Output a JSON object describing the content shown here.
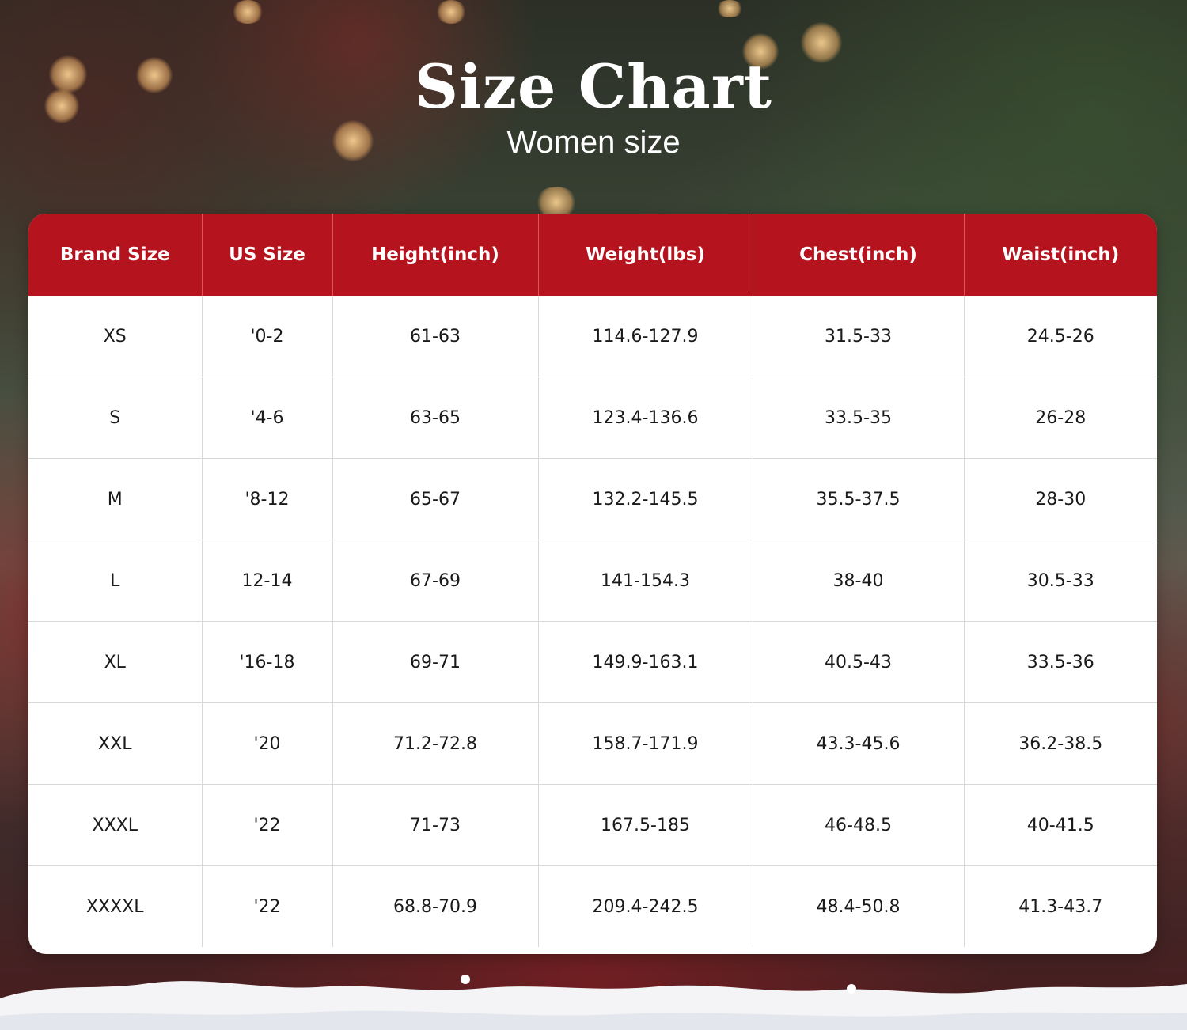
{
  "header": {
    "title": "Size Chart",
    "subtitle": "Women size"
  },
  "table": {
    "columns": [
      "Brand Size",
      "US Size",
      "Height(inch)",
      "Weight(lbs)",
      "Chest(inch)",
      "Waist(inch)"
    ],
    "rows": [
      [
        "XS",
        "'0-2",
        "61-63",
        "114.6-127.9",
        "31.5-33",
        "24.5-26"
      ],
      [
        "S",
        "'4-6",
        "63-65",
        "123.4-136.6",
        "33.5-35",
        "26-28"
      ],
      [
        "M",
        "'8-12",
        "65-67",
        "132.2-145.5",
        "35.5-37.5",
        "28-30"
      ],
      [
        "L",
        "12-14",
        "67-69",
        "141-154.3",
        "38-40",
        "30.5-33"
      ],
      [
        "XL",
        "'16-18",
        "69-71",
        "149.9-163.1",
        "40.5-43",
        "33.5-36"
      ],
      [
        "XXL",
        "'20",
        "71.2-72.8",
        "158.7-171.9",
        "43.3-45.6",
        "36.2-38.5"
      ],
      [
        "XXXL",
        "'22",
        "71-73",
        "167.5-185",
        "46-48.5",
        "40-41.5"
      ],
      [
        "XXXXL",
        "'22",
        "68.8-70.9",
        "209.4-242.5",
        "48.4-50.8",
        "41.3-43.7"
      ]
    ]
  },
  "colors": {
    "header_red": "#b5141e",
    "card_bg": "#ffffff",
    "text_dark": "#1a1a1a",
    "title_white": "#ffffff"
  }
}
